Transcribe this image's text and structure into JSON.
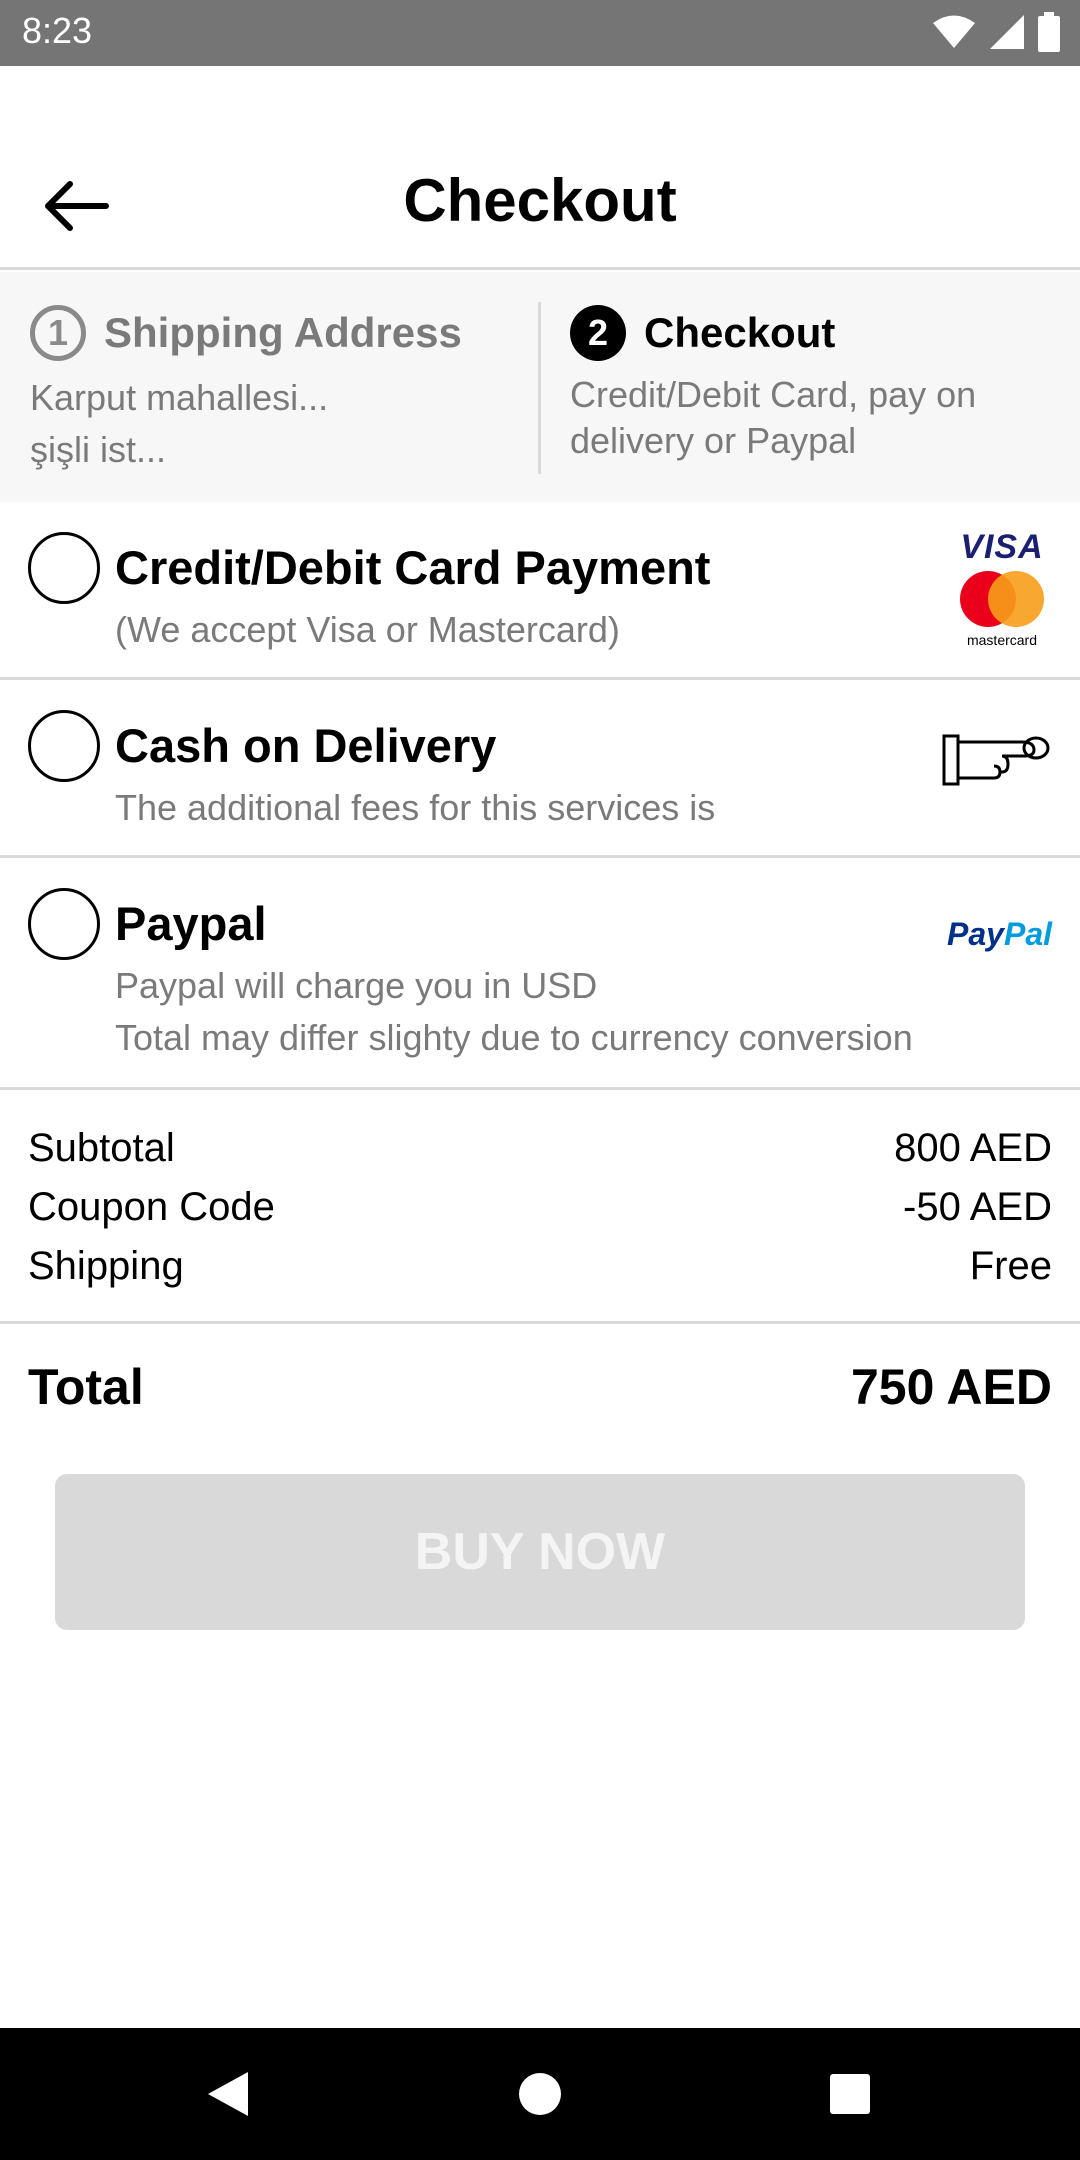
{
  "status_bar": {
    "time": "8:23",
    "icons": [
      "wifi-icon",
      "signal-icon",
      "battery-icon"
    ]
  },
  "header": {
    "title": "Checkout",
    "back_icon": "arrow-left-icon"
  },
  "steps": [
    {
      "number": "1",
      "title": "Shipping Address",
      "desc_line1": "Karput mahallesi...",
      "desc_line2": "şişli ist..."
    },
    {
      "number": "2",
      "title": "Checkout",
      "desc_line1": "Credit/Debit Card, pay on",
      "desc_line2": "delivery or Paypal"
    }
  ],
  "payment_options": {
    "card": {
      "title": "Credit/Debit Card Payment",
      "sub": "(We accept Visa or Mastercard)",
      "visa_label": "VISA",
      "mastercard_label": "mastercard"
    },
    "cash": {
      "title": "Cash on Delivery",
      "sub": "The additional fees for this services is",
      "icon": "hand-cash-icon"
    },
    "paypal": {
      "title": "Paypal",
      "sub_line1": "Paypal will charge you in USD",
      "sub_line2": "Total may differ slighty due to currency conversion",
      "logo_pay": "Pay",
      "logo_pal": "Pal"
    }
  },
  "summary": {
    "rows": [
      {
        "label": "Subtotal",
        "value": "800 AED"
      },
      {
        "label": "Coupon Code",
        "value": "-50 AED"
      },
      {
        "label": "Shipping",
        "value": "Free"
      }
    ],
    "total_label": "Total",
    "total_value": "750 AED"
  },
  "buy_button": {
    "label": "BUY NOW",
    "enabled": false
  },
  "colors": {
    "muted_text": "#7a7a7a",
    "divider": "#d9d9d9",
    "disabled_button": "#d9d9d9",
    "visa_blue": "#1a1f71",
    "mc_red": "#eb001b",
    "mc_orange": "#f79e1b",
    "paypal_dark": "#003087",
    "paypal_light": "#009cde"
  },
  "nav_bar": {
    "buttons": [
      "back-triangle-icon",
      "home-circle-icon",
      "recents-square-icon"
    ]
  }
}
